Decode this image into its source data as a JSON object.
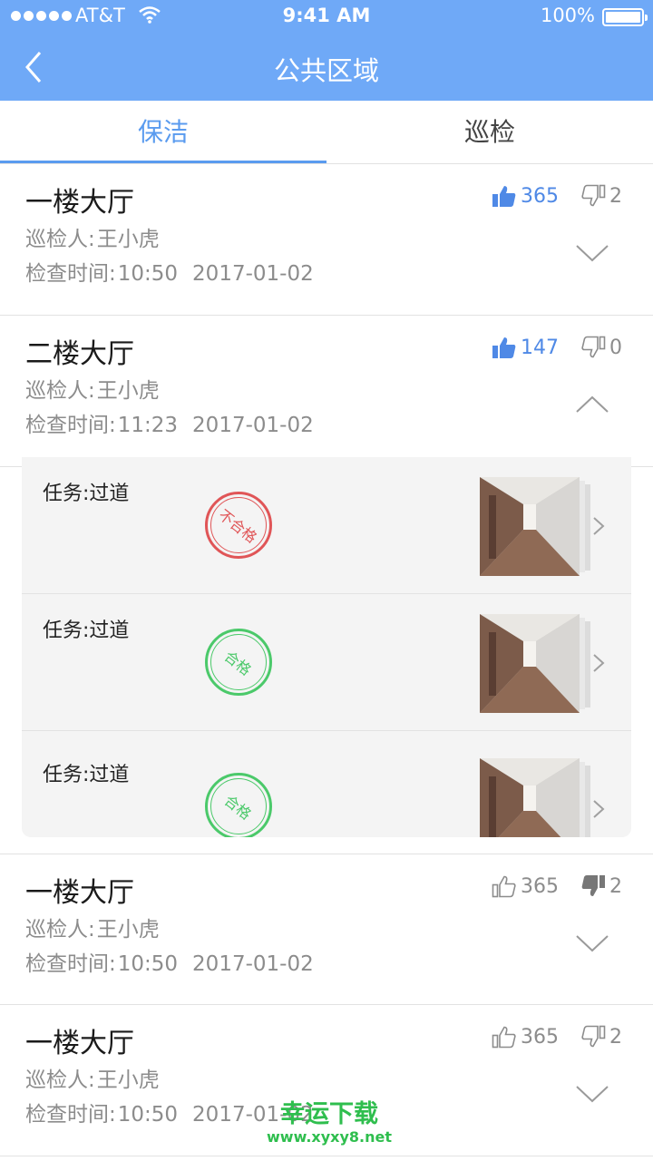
{
  "status_bar": {
    "carrier": "AT&T",
    "time": "9:41 AM",
    "battery": "100%"
  },
  "header": {
    "title": "公共区域"
  },
  "tabs": [
    {
      "label": "保洁",
      "active": true
    },
    {
      "label": "巡检",
      "active": false
    }
  ],
  "labels": {
    "inspector": "巡检人:",
    "check_time": "检查时间:",
    "task": "任务:"
  },
  "records": [
    {
      "name": "一楼大厅",
      "inspector": "王小虎",
      "time": "10:50",
      "date": "2017-01-02",
      "likes": "365",
      "dislikes": "2",
      "liked": true,
      "disliked": false,
      "expanded": false
    },
    {
      "name": "二楼大厅",
      "inspector": "王小虎",
      "time": "11:23",
      "date": "2017-01-02",
      "likes": "147",
      "dislikes": "0",
      "liked": true,
      "disliked": false,
      "expanded": true
    },
    {
      "name": "一楼大厅",
      "inspector": "王小虎",
      "time": "10:50",
      "date": "2017-01-02",
      "likes": "365",
      "dislikes": "2",
      "liked": false,
      "disliked": true,
      "expanded": false
    },
    {
      "name": "一楼大厅",
      "inspector": "王小虎",
      "time": "10:50",
      "date": "2017-01-02",
      "likes": "365",
      "dislikes": "2",
      "liked": false,
      "disliked": false,
      "expanded": false
    }
  ],
  "tasks": [
    {
      "name": "过道",
      "result": "不合格",
      "passed": false
    },
    {
      "name": "过道",
      "result": "合格",
      "passed": true
    },
    {
      "name": "过道",
      "result": "合格",
      "passed": true
    }
  ],
  "watermark": {
    "text": "幸运下载",
    "url": "www.xyxy8.net"
  },
  "colors": {
    "header": "#6fa9f7",
    "accent": "#5a9bef",
    "like": "#4f89e6",
    "fail": "#e05557",
    "pass": "#4bc96a"
  }
}
